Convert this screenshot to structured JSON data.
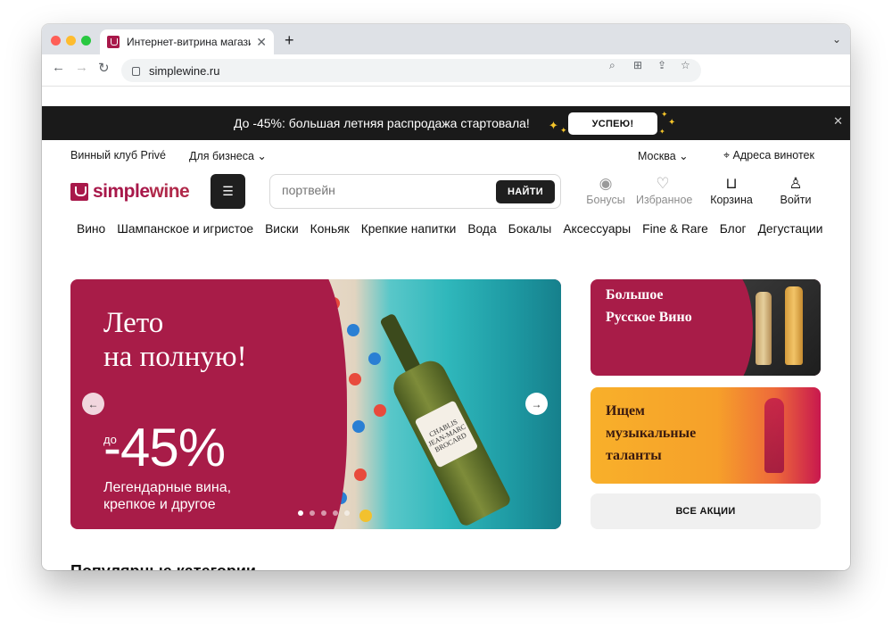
{
  "browser": {
    "tab_title": "Интернет-витрина магазина",
    "url": "simplewine.ru",
    "new_tab": "+",
    "tab_close": "✕"
  },
  "promo": {
    "text": "До -45%: большая летняя распродажа стартовала!",
    "button": "УСПЕЮ!",
    "close": "✕"
  },
  "header": {
    "club": "Винный клуб Privé",
    "business": "Для бизнеса",
    "city": "Москва",
    "stores": "Адреса винотек",
    "logo_simple": "simple",
    "logo_wine": "wine",
    "search_placeholder": "портвейн",
    "search_button": "НАЙТИ",
    "actions": {
      "bonus": "Бонусы",
      "favorites": "Избранное",
      "cart": "Корзина",
      "login": "Войти"
    }
  },
  "categories": [
    "Вино",
    "Шампанское и игристое",
    "Виски",
    "Коньяк",
    "Крепкие напитки",
    "Вода",
    "Бокалы",
    "Аксессуары",
    "Fine & Rare",
    "Блог",
    "Дегустации"
  ],
  "hero": {
    "title_line1": "Лето",
    "title_line2": "на полную!",
    "prefix": "до",
    "discount": "-45%",
    "subtitle_line1": "Легендарные вина,",
    "subtitle_line2": "крепкое и другое",
    "bottle_label": "CHABLIS JEAN-MARC BROCARD",
    "slide_count": 5,
    "active_slide": 1
  },
  "side_banners": {
    "card1_line1": "Большое",
    "card1_line2": "Русское Вино",
    "card2_line1": "Ищем",
    "card2_line2": "музыкальные",
    "card2_line3": "таланты",
    "all_promos": "ВСЕ АКЦИИ"
  },
  "section_heading": "Популярные категории",
  "colors": {
    "brand": "#a81c48",
    "dark": "#1f1f1f",
    "promo_bar": "#1a1a1a",
    "accent_orange": "#f8b02a"
  }
}
